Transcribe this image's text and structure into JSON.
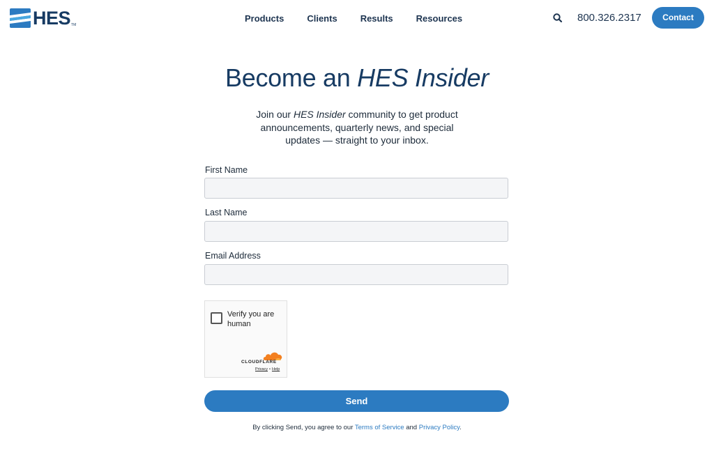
{
  "header": {
    "logo_text": "HES",
    "logo_tm": "TM",
    "nav": [
      "Products",
      "Clients",
      "Results",
      "Resources"
    ],
    "phone": "800.326.2317",
    "contact_label": "Contact"
  },
  "hero": {
    "title_prefix": "Become an ",
    "title_emphasis": "HES Insider",
    "intro_prefix": "Join our ",
    "intro_emphasis": "HES Insider",
    "intro_rest": " community to get product announcements, quarterly news, and special updates — straight to your inbox."
  },
  "form": {
    "first_name_label": "First Name",
    "first_name_value": "",
    "last_name_label": "Last Name",
    "last_name_value": "",
    "email_label": "Email Address",
    "email_value": "",
    "send_label": "Send"
  },
  "turnstile": {
    "checkbox_text": "Verify you are human",
    "brand": "CLOUDFLARE",
    "privacy_link": "Privacy",
    "separator": "•",
    "help_link": "Help"
  },
  "legal": {
    "prefix": "By clicking Send, you agree to our ",
    "terms_link": "Terms of Service",
    "and": " and ",
    "privacy_link": "Privacy Policy",
    "suffix": "."
  },
  "colors": {
    "brand_navy": "#173b63",
    "accent_blue": "#2c7bc1",
    "logo_light_blue": "#4aa8e0",
    "cloudflare_orange": "#f38020"
  },
  "icons": {
    "logo": "hes-logo-icon",
    "search": "search-icon",
    "cloud": "cloudflare-cloud-icon"
  }
}
